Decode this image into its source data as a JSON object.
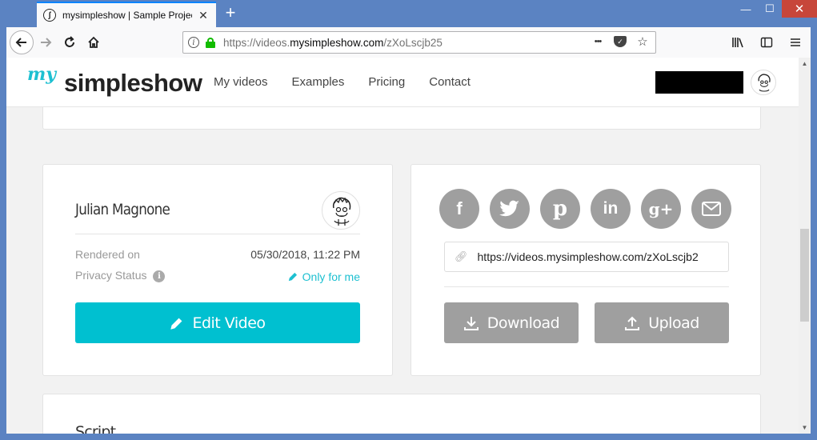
{
  "browser": {
    "tab_title": "mysimpleshow | Sample Projec",
    "tab_close": "✕",
    "new_tab": "+",
    "url_prefix": "https://videos.",
    "url_domain": "mysimpleshow.com",
    "url_path": "/zXoLscjb25",
    "more_icon": "•••",
    "minimize": "—",
    "maximize": "☐",
    "close": "✕"
  },
  "site": {
    "logo_my": "my",
    "logo_main": "simpleshow",
    "nav": [
      "My videos",
      "Examples",
      "Pricing",
      "Contact"
    ]
  },
  "video": {
    "author": "Julian Magnone",
    "rendered_label": "Rendered on",
    "rendered_value": "05/30/2018, 11:22 PM",
    "privacy_label": "Privacy Status",
    "privacy_value": "Only for me",
    "edit_label": "Edit Video"
  },
  "share": {
    "social": [
      "facebook-icon",
      "twitter-icon",
      "pinterest-icon",
      "linkedin-icon",
      "google-plus-icon",
      "mail-icon"
    ],
    "url": "https://videos.mysimpleshow.com/zXoLscjb2",
    "download_label": "Download",
    "upload_label": "Upload"
  },
  "script": {
    "title": "Script"
  },
  "colors": {
    "accent": "#00c0d0",
    "grey_button": "#9f9f9f",
    "browser_frame": "#5b83c2"
  }
}
